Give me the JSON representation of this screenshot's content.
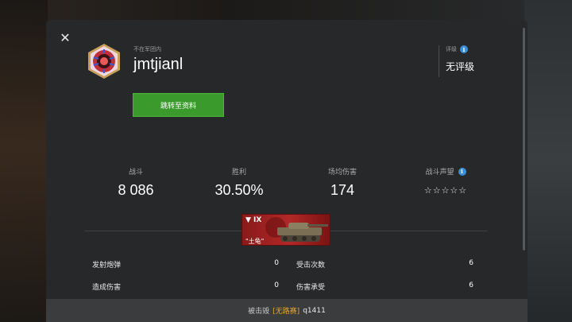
{
  "player": {
    "clan_status": "不在军团内",
    "nickname": "jmtjianl",
    "goto_button": "跳转至资料"
  },
  "rating": {
    "label": "评级",
    "value": "无评级"
  },
  "stats": {
    "battles_label": "战斗",
    "battles_value": "8 086",
    "winrate_label": "胜利",
    "winrate_value": "30.50%",
    "avg_damage_label": "场均伤害",
    "avg_damage_value": "174",
    "prestige_label": "战斗声望",
    "prestige_stars": "☆☆☆☆☆",
    "prestige_rating": 0
  },
  "tank": {
    "tier": "▼ IX",
    "name": "\"土龟\""
  },
  "battle_stats": [
    {
      "left_label": "发射炮弹",
      "left_value": "0",
      "right_label": "受击次数",
      "right_value": "6"
    },
    {
      "left_label": "造成伤害",
      "left_value": "0",
      "right_label": "伤害承受",
      "right_value": "6"
    }
  ],
  "kill_info": {
    "prefix": "被击毁",
    "clan_tag": "[无路赛]",
    "killer": "q1411"
  },
  "colors": {
    "accent_green": "#3a9a2c",
    "info_blue": "#3b8fd6",
    "clan_tag_orange": "#e8a632"
  }
}
